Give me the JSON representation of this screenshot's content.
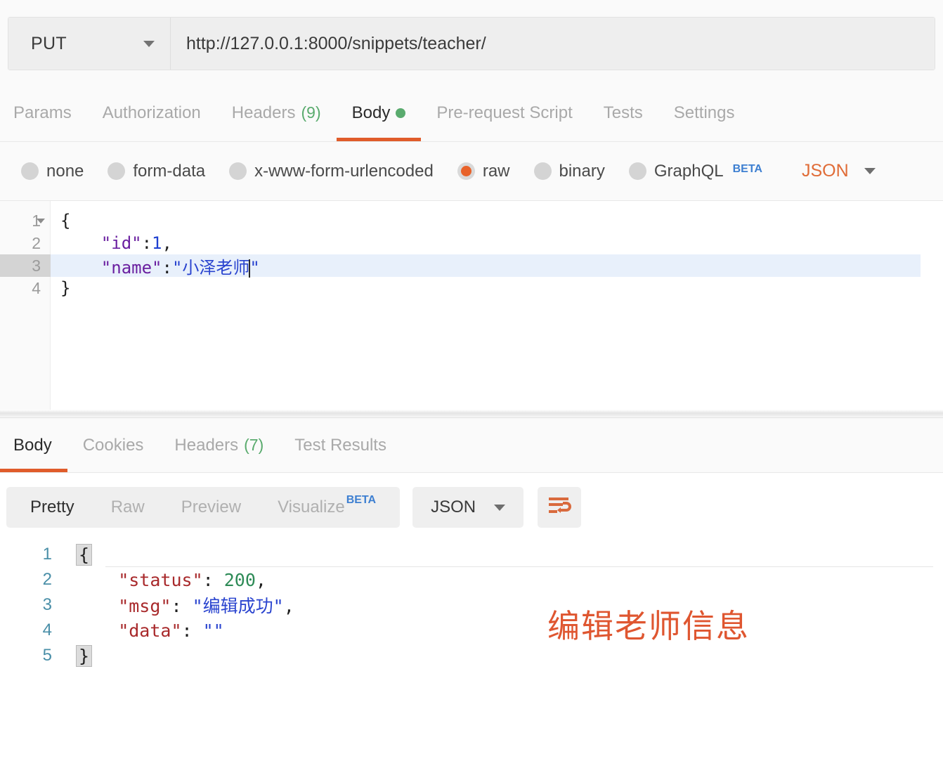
{
  "request_bar": {
    "method": "PUT",
    "method_caret_icon": "chevron-down-icon",
    "url": "http://127.0.0.1:8000/snippets/teacher/",
    "url_placeholder": "Enter request URL"
  },
  "request_tabs": [
    {
      "label": "Params",
      "count": "",
      "active": false
    },
    {
      "label": "Authorization",
      "count": "",
      "active": false
    },
    {
      "label": "Headers",
      "count": "(9)",
      "active": false
    },
    {
      "label": "Body",
      "count": "",
      "active": true,
      "dot": true
    },
    {
      "label": "Pre-request Script",
      "count": "",
      "active": false
    },
    {
      "label": "Tests",
      "count": "",
      "active": false
    },
    {
      "label": "Settings",
      "count": "",
      "active": false
    }
  ],
  "body_types": [
    {
      "label": "none",
      "selected": false
    },
    {
      "label": "form-data",
      "selected": false
    },
    {
      "label": "x-www-form-urlencoded",
      "selected": false
    },
    {
      "label": "raw",
      "selected": true
    },
    {
      "label": "binary",
      "selected": false
    },
    {
      "label": "GraphQL",
      "selected": false,
      "badge": "BETA"
    }
  ],
  "body_format": {
    "label": "JSON",
    "caret_icon": "chevron-down-icon"
  },
  "request_body": {
    "lines": [
      {
        "number": "1",
        "foldable": true,
        "highlighted": false,
        "tokens": [
          {
            "t": "{",
            "c": "tok-brace"
          }
        ]
      },
      {
        "number": "2",
        "foldable": false,
        "highlighted": false,
        "tokens": [
          {
            "t": "    \"id\"",
            "c": "tok-key"
          },
          {
            "t": ":",
            "c": "tok-punc"
          },
          {
            "t": "1",
            "c": "tok-num"
          },
          {
            "t": ",",
            "c": "tok-punc"
          }
        ]
      },
      {
        "number": "3",
        "foldable": false,
        "highlighted": true,
        "tokens": [
          {
            "t": "    \"name\"",
            "c": "tok-key"
          },
          {
            "t": ":",
            "c": "tok-punc"
          },
          {
            "t": "\"小泽老师",
            "c": "tok-str"
          },
          {
            "t": "CARET",
            "c": "caret"
          },
          {
            "t": "\"",
            "c": "tok-str"
          }
        ]
      },
      {
        "number": "4",
        "foldable": false,
        "highlighted": false,
        "tokens": [
          {
            "t": "}",
            "c": "tok-brace"
          }
        ]
      }
    ]
  },
  "response_tabs": [
    {
      "label": "Body",
      "count": "",
      "active": true
    },
    {
      "label": "Cookies",
      "count": "",
      "active": false
    },
    {
      "label": "Headers",
      "count": "(7)",
      "active": false
    },
    {
      "label": "Test Results",
      "count": "",
      "active": false
    }
  ],
  "response_toolbar": {
    "view_modes": [
      {
        "label": "Pretty",
        "active": true
      },
      {
        "label": "Raw",
        "active": false
      },
      {
        "label": "Preview",
        "active": false
      },
      {
        "label": "Visualize",
        "active": false,
        "badge": "BETA"
      }
    ],
    "format": {
      "label": "JSON",
      "caret_icon": "chevron-down-icon"
    },
    "wrap_button_icon": "word-wrap-icon"
  },
  "response_body": {
    "lines": [
      {
        "number": "1",
        "tokens": [
          {
            "t": "{",
            "c": "brace-box"
          }
        ]
      },
      {
        "number": "2",
        "tokens": [
          {
            "t": "    \"status\"",
            "c": "rtok-key"
          },
          {
            "t": ": ",
            "c": "rtok-punc"
          },
          {
            "t": "200",
            "c": "rtok-num"
          },
          {
            "t": ",",
            "c": "rtok-punc"
          }
        ]
      },
      {
        "number": "3",
        "tokens": [
          {
            "t": "    \"msg\"",
            "c": "rtok-key"
          },
          {
            "t": ": ",
            "c": "rtok-punc"
          },
          {
            "t": "\"编辑成功\"",
            "c": "rtok-str"
          },
          {
            "t": ",",
            "c": "rtok-punc"
          }
        ]
      },
      {
        "number": "4",
        "tokens": [
          {
            "t": "    \"data\"",
            "c": "rtok-key"
          },
          {
            "t": ": ",
            "c": "rtok-punc"
          },
          {
            "t": "\"\"",
            "c": "rtok-str"
          }
        ]
      },
      {
        "number": "5",
        "tokens": [
          {
            "t": "}",
            "c": "brace-box"
          }
        ]
      }
    ]
  },
  "annotation": {
    "text": "编辑老师信息",
    "color": "#df5630"
  }
}
